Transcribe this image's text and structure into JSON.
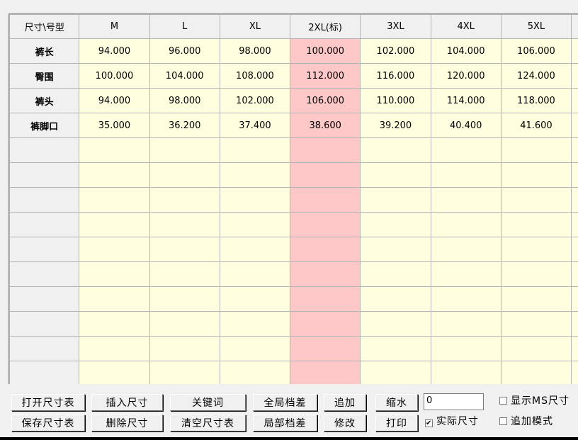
{
  "grid": {
    "corner_label": "尺寸\\号型",
    "columns": [
      "M",
      "L",
      "XL",
      "2XL(标)",
      "3XL",
      "4XL",
      "5XL"
    ],
    "highlight_column_index": 3,
    "rows": [
      {
        "label": "裤长",
        "values": [
          "94.000",
          "96.000",
          "98.000",
          "100.000",
          "102.000",
          "104.000",
          "106.000"
        ]
      },
      {
        "label": "臀围",
        "values": [
          "100.000",
          "104.000",
          "108.000",
          "112.000",
          "116.000",
          "120.000",
          "124.000"
        ]
      },
      {
        "label": "裤头",
        "values": [
          "94.000",
          "98.000",
          "102.000",
          "106.000",
          "110.000",
          "114.000",
          "118.000"
        ]
      },
      {
        "label": "裤脚口",
        "values": [
          "35.000",
          "36.200",
          "37.400",
          "38.600",
          "39.200",
          "40.400",
          "41.600"
        ]
      }
    ],
    "empty_rows": 10,
    "colors": {
      "cell_bg": "#ffffe0",
      "highlight_bg": "#ffc8c8",
      "header_bg": "#f0f0f0"
    }
  },
  "buttons": {
    "open_table": "打开尺寸表",
    "save_table": "保存尺寸表",
    "insert_size": "插入尺寸",
    "delete_size": "删除尺寸",
    "keyword": "关键词",
    "clear_table": "清空尺寸表",
    "global_grade": "全局档差",
    "local_grade": "局部档差",
    "append": "追加",
    "modify": "修改",
    "shrink": "缩水",
    "print": "打印"
  },
  "shrink_input": {
    "value": "0"
  },
  "checkboxes": {
    "show_ms": {
      "label": "显示MS尺寸",
      "checked": false
    },
    "actual_size": {
      "label": "实际尺寸",
      "checked": true
    },
    "append_mode": {
      "label": "追加模式",
      "checked": false
    }
  }
}
